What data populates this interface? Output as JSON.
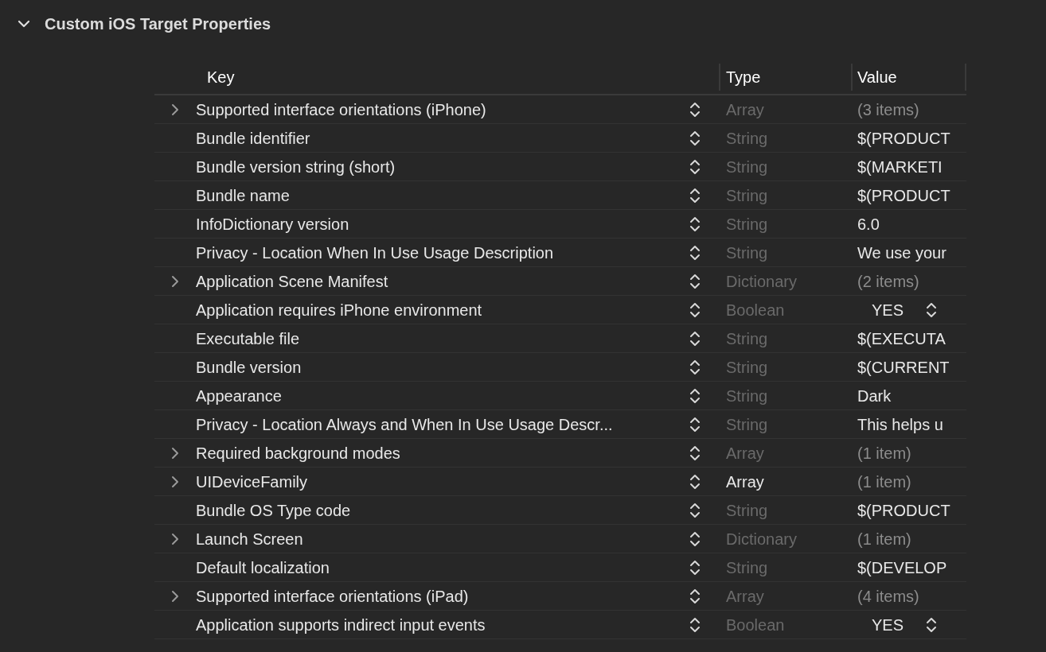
{
  "section": {
    "title": "Custom iOS Target Properties",
    "expanded": true
  },
  "columns": [
    "Key",
    "Type",
    "Value"
  ],
  "rows": [
    {
      "key": "Supported interface orientations (iPhone)",
      "expandable": true,
      "type": "Array",
      "type_dimmed": true,
      "value": "(3 items)",
      "kind": "count"
    },
    {
      "key": "Bundle identifier",
      "expandable": false,
      "type": "String",
      "type_dimmed": true,
      "value": "$(PRODUCT",
      "kind": "text"
    },
    {
      "key": "Bundle version string (short)",
      "expandable": false,
      "type": "String",
      "type_dimmed": true,
      "value": "$(MARKETI",
      "kind": "text"
    },
    {
      "key": "Bundle name",
      "expandable": false,
      "type": "String",
      "type_dimmed": true,
      "value": "$(PRODUCT",
      "kind": "text"
    },
    {
      "key": "InfoDictionary version",
      "expandable": false,
      "type": "String",
      "type_dimmed": true,
      "value": "6.0",
      "kind": "text"
    },
    {
      "key": "Privacy - Location When In Use Usage Description",
      "expandable": false,
      "type": "String",
      "type_dimmed": true,
      "value": "We use your",
      "kind": "text"
    },
    {
      "key": "Application Scene Manifest",
      "expandable": true,
      "type": "Dictionary",
      "type_dimmed": true,
      "value": "(2 items)",
      "kind": "count"
    },
    {
      "key": "Application requires iPhone environment",
      "expandable": false,
      "type": "Boolean",
      "type_dimmed": true,
      "value": "YES",
      "kind": "bool"
    },
    {
      "key": "Executable file",
      "expandable": false,
      "type": "String",
      "type_dimmed": true,
      "value": "$(EXECUTA",
      "kind": "text"
    },
    {
      "key": "Bundle version",
      "expandable": false,
      "type": "String",
      "type_dimmed": true,
      "value": "$(CURRENT",
      "kind": "text"
    },
    {
      "key": "Appearance",
      "expandable": false,
      "type": "String",
      "type_dimmed": true,
      "value": "Dark",
      "kind": "text"
    },
    {
      "key": "Privacy - Location Always and When In Use Usage Descr...",
      "expandable": false,
      "type": "String",
      "type_dimmed": true,
      "value": "This helps u",
      "kind": "text"
    },
    {
      "key": "Required background modes",
      "expandable": true,
      "type": "Array",
      "type_dimmed": true,
      "value": "(1 item)",
      "kind": "count"
    },
    {
      "key": "UIDeviceFamily",
      "expandable": true,
      "type": "Array",
      "type_dimmed": false,
      "value": "(1 item)",
      "kind": "count"
    },
    {
      "key": "Bundle OS Type code",
      "expandable": false,
      "type": "String",
      "type_dimmed": true,
      "value": "$(PRODUCT",
      "kind": "text"
    },
    {
      "key": "Launch Screen",
      "expandable": true,
      "type": "Dictionary",
      "type_dimmed": true,
      "value": "(1 item)",
      "kind": "count"
    },
    {
      "key": "Default localization",
      "expandable": false,
      "type": "String",
      "type_dimmed": true,
      "value": "$(DEVELOP",
      "kind": "text"
    },
    {
      "key": "Supported interface orientations (iPad)",
      "expandable": true,
      "type": "Array",
      "type_dimmed": true,
      "value": "(4 items)",
      "kind": "count"
    },
    {
      "key": "Application supports indirect input events",
      "expandable": false,
      "type": "Boolean",
      "type_dimmed": true,
      "value": "YES",
      "kind": "bool"
    }
  ]
}
